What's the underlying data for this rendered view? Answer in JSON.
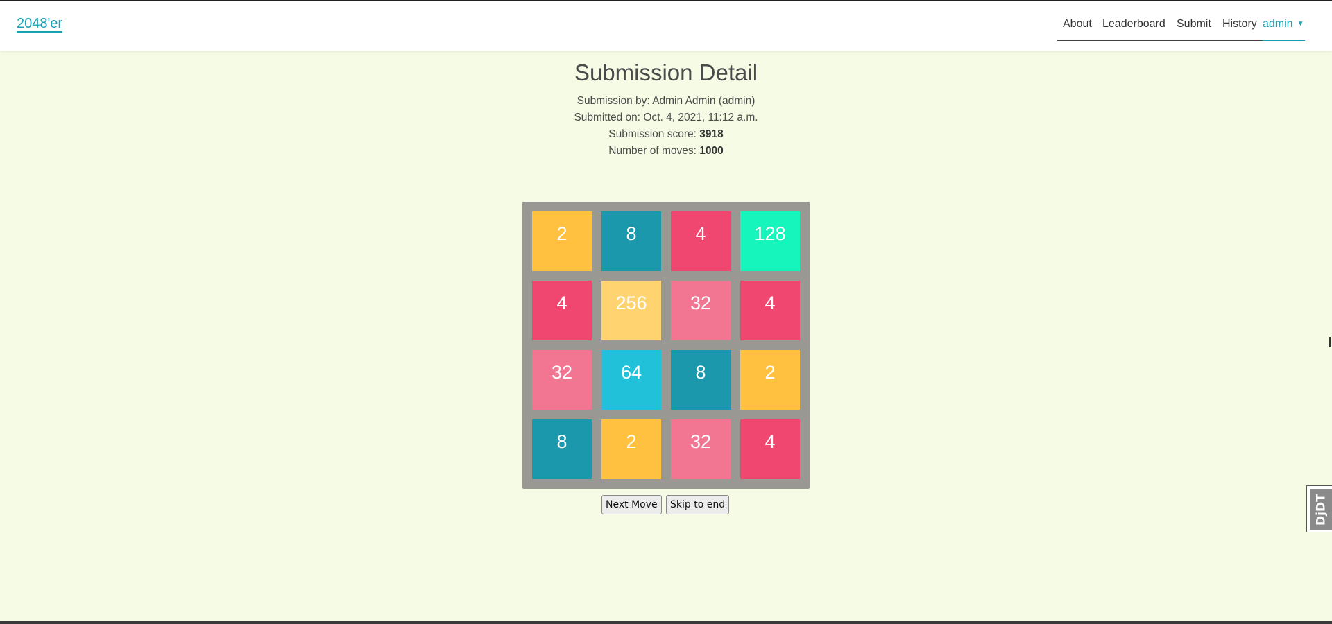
{
  "nav": {
    "brand": "2048'er",
    "items": [
      {
        "label": "About"
      },
      {
        "label": "Leaderboard"
      },
      {
        "label": "Submit"
      },
      {
        "label": "History"
      }
    ],
    "user": "admin"
  },
  "page": {
    "title": "Submission Detail",
    "by_label": "Submission by:",
    "by_value": "Admin Admin (admin)",
    "date_label": "Submitted on:",
    "date_value": "Oct. 4, 2021, 11:12 a.m.",
    "score_label": "Submission score:",
    "score_value": "3918",
    "moves_label": "Number of moves:",
    "moves_value": "1000"
  },
  "board": {
    "rows": [
      [
        2,
        8,
        4,
        128
      ],
      [
        4,
        256,
        32,
        4
      ],
      [
        32,
        64,
        8,
        2
      ],
      [
        8,
        2,
        32,
        4
      ]
    ],
    "tile_colors": {
      "2": "#ffc13f",
      "4": "#ef476f",
      "8": "#1b98ab",
      "32": "#f27592",
      "64": "#21c2d9",
      "128": "#15f5bc",
      "256": "#ffd470"
    }
  },
  "controls": {
    "next_label": "Next Move",
    "skip_label": "Skip to end"
  },
  "debug_toolbar": {
    "label": "DjDT"
  }
}
